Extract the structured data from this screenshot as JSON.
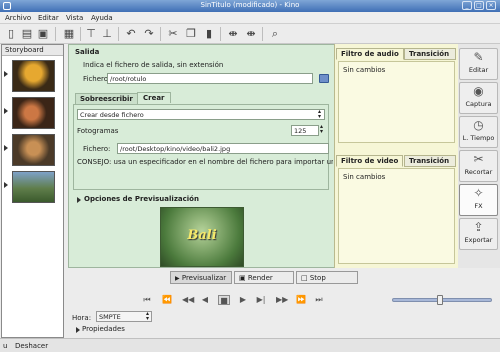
{
  "window": {
    "title": "SinTitulo (modificado) - Kino"
  },
  "menu": [
    "Archivo",
    "Editar",
    "Vista",
    "Ayuda"
  ],
  "storyboard": {
    "title": "Storyboard"
  },
  "output": {
    "section_title": "Salida",
    "hint": "Indica el fichero de salida, sin extensión",
    "file_label": "Fichero",
    "file_value": "/root/rotulo",
    "tabs": [
      "Sobreescribir",
      "Crear"
    ],
    "mode_select": "Crear desde fichero",
    "frames_label": "Fotogramas",
    "frames_value": "125",
    "file2_label": "Fichero:",
    "file2_value": "/root/Desktop/kino/video/bali2.jpg",
    "tip": "CONSEJO: usa un especificador en el nombre del fichero para importar una sec"
  },
  "audio_panel": {
    "tabs": [
      "Filtro de audio",
      "Transición"
    ],
    "value": "Sin cambios"
  },
  "video_panel": {
    "tabs": [
      "Filtro de video",
      "Transición"
    ],
    "value": "Sin cambios"
  },
  "preview": {
    "title": "Opciones de Previsualización",
    "image_caption": "Bali"
  },
  "actions": {
    "preview": "Previsualizar",
    "render": "Render",
    "stop": "Stop"
  },
  "side_buttons": [
    "Editar",
    "Captura",
    "L. Tiempo",
    "Recortar",
    "FX",
    "Exportar"
  ],
  "time": {
    "label": "Hora:",
    "value": "SMPTE"
  },
  "properties_label": "Propiedades",
  "status": {
    "prefix": "u",
    "text": "Deshacer"
  }
}
